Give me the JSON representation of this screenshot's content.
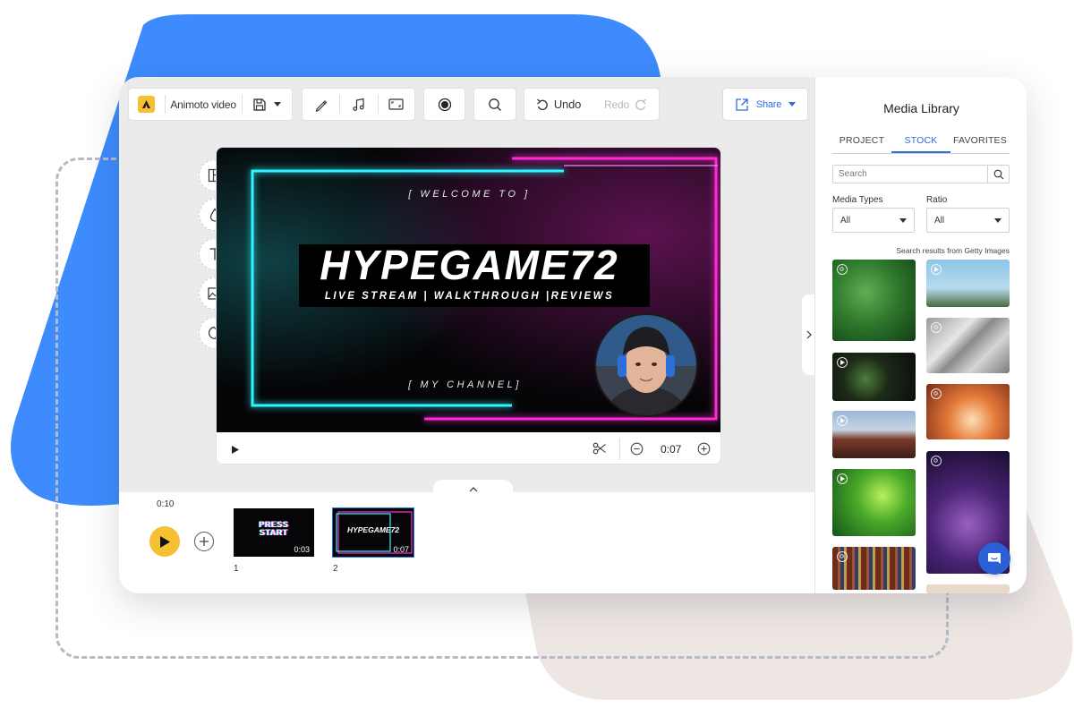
{
  "toolbar": {
    "project_name": "Animoto video",
    "undo_label": "Undo",
    "redo_label": "Redo",
    "share_label": "Share"
  },
  "scene": {
    "welcome_text": "[ WELCOME TO ]",
    "channel_name": "HYPEGAME72",
    "tagline": "LIVE STREAM | WALKTHROUGH |REVIEWS",
    "my_channel_text": "[ MY CHANNEL]"
  },
  "player": {
    "current_time": "0:07"
  },
  "timeline": {
    "total_duration": "0:10",
    "blocks": [
      {
        "number": "1",
        "duration": "0:03",
        "title_line1": "PRESS",
        "title_line2": "START"
      },
      {
        "number": "2",
        "duration": "0:07",
        "title": "HYPEGAME72"
      }
    ]
  },
  "media_library": {
    "title": "Media Library",
    "tabs": [
      "PROJECT",
      "STOCK",
      "FAVORITES"
    ],
    "active_tab": "STOCK",
    "search_placeholder": "Search",
    "media_types_label": "Media Types",
    "media_types_value": "All",
    "ratio_label": "Ratio",
    "ratio_value": "All",
    "results_source": "Search results from Getty Images"
  },
  "colors": {
    "accent_yellow": "#f6c033",
    "brand_blue": "#2a6fdb",
    "neon_cyan": "#2ff5ff",
    "neon_magenta": "#ff2bd6",
    "shape_blue": "#3d8bfd",
    "shape_beige": "#ede6e3"
  },
  "icons": {
    "logo": "animoto-logo-icon",
    "save": "save-icon",
    "pen": "pen-icon",
    "music": "music-note-icon",
    "resize": "aspect-ratio-icon",
    "record": "record-icon",
    "search": "search-icon",
    "undo": "undo-icon",
    "redo": "redo-icon",
    "share": "share-icon"
  }
}
